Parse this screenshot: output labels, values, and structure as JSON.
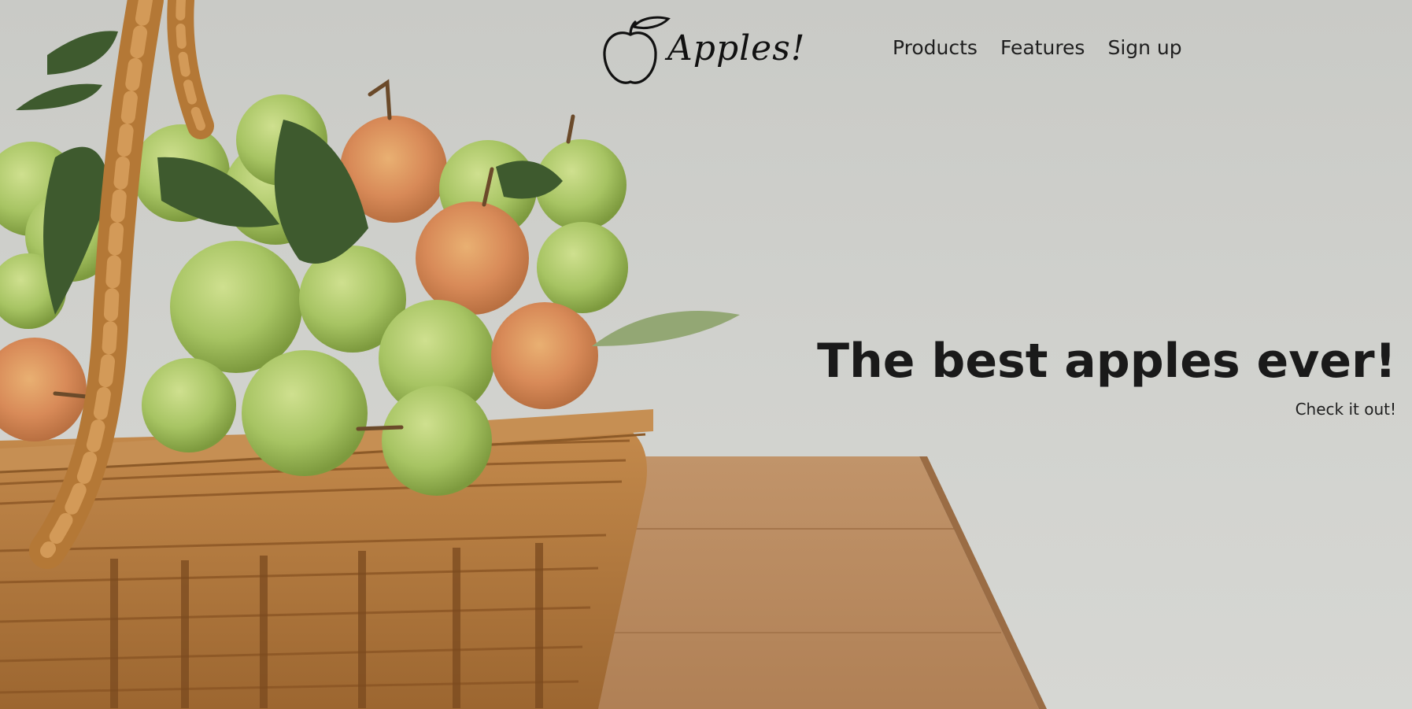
{
  "brand": {
    "name": "Apples!"
  },
  "nav": {
    "items": [
      {
        "label": "Products"
      },
      {
        "label": "Features"
      },
      {
        "label": "Sign up"
      }
    ]
  },
  "hero": {
    "headline": "The best apples ever!",
    "subline": "Check it out!"
  },
  "colors": {
    "background": "#cfd0cc",
    "table_wood": "#b98a5e",
    "apple_green": "#a9c46a",
    "basket": "#b27a3e",
    "text": "#1a1a1a"
  }
}
